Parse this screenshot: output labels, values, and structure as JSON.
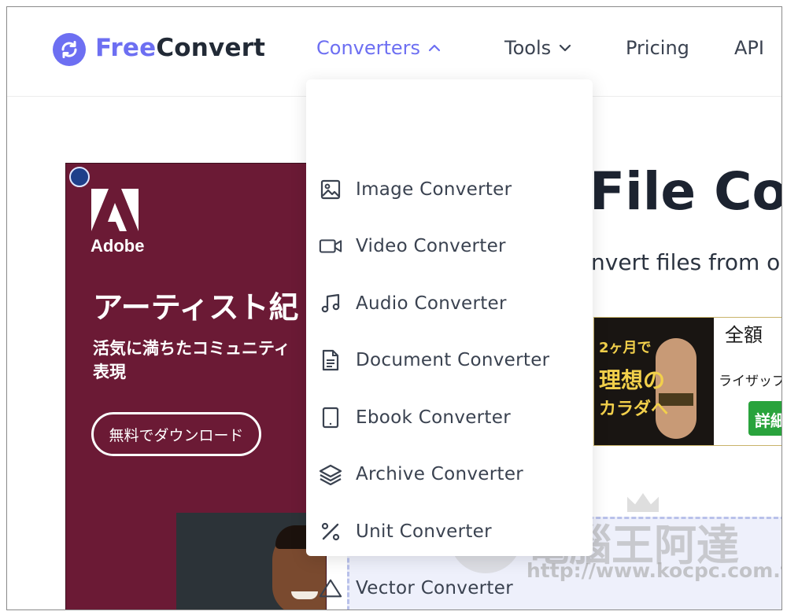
{
  "header": {
    "logo": {
      "free": "Free",
      "convert": "Convert"
    },
    "nav": [
      {
        "label": "Converters"
      },
      {
        "label": "Tools"
      },
      {
        "label": "Pricing"
      },
      {
        "label": "API"
      }
    ]
  },
  "dropdown": {
    "items": [
      {
        "label": "Image Converter",
        "icon": "image-icon"
      },
      {
        "label": "Video Converter",
        "icon": "video-camera-icon"
      },
      {
        "label": "Audio Converter",
        "icon": "music-note-icon"
      },
      {
        "label": "Document Converter",
        "icon": "document-icon"
      },
      {
        "label": "Ebook Converter",
        "icon": "ebook-icon"
      },
      {
        "label": "Archive Converter",
        "icon": "layers-icon"
      },
      {
        "label": "Unit Converter",
        "icon": "percent-icon"
      },
      {
        "label": "Vector Converter",
        "icon": "triangle-icon"
      }
    ]
  },
  "hero": {
    "title": "File Co",
    "subtitle": "nvert files from o"
  },
  "ad_left": {
    "brand": "Adobe",
    "headline": "アーティスト紀",
    "subline": "活気に満ちたコミュニティ\n表現",
    "button": "無料でダウンロード"
  },
  "ad_right": {
    "line1": "2ヶ月で",
    "line2": "理想の",
    "line3": "カラダへ",
    "right_title": "全額",
    "right_sub": "ライザップ",
    "cta": "詳細"
  },
  "watermark": {
    "text": "電腦王阿達",
    "url": "http://www.kocpc.com.tw"
  },
  "colors": {
    "brand": "#6d6ff2",
    "text": "#3a4250",
    "ad_bg": "#6b1a35"
  }
}
